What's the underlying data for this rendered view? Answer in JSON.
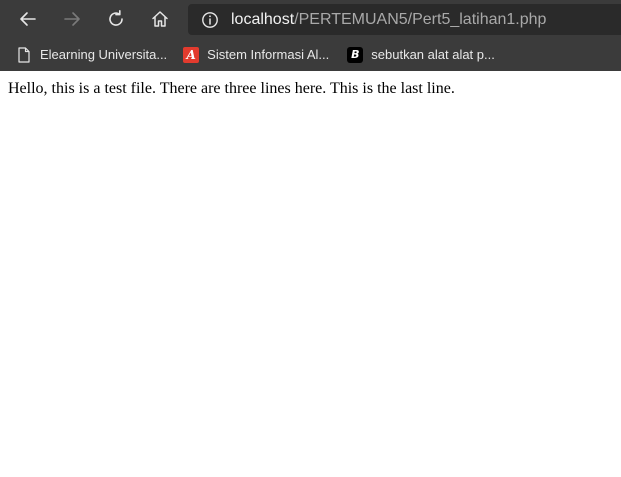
{
  "browser": {
    "address_bar": {
      "url_host": "localhost",
      "url_path": "/PERTEMUAN5/Pert5_latihan1.php"
    },
    "bookmarks": [
      {
        "label": "Elearning Universita...",
        "icon": "page-icon"
      },
      {
        "label": "Sistem Informasi Al...",
        "icon": "red-a-badge-icon"
      },
      {
        "label": "sebutkan alat alat p...",
        "icon": "black-b-badge-icon"
      }
    ],
    "colors": {
      "chrome": "#3b3b3b",
      "address_bar": "#2a2a2a",
      "text_light": "#f2f2f2",
      "text_dim": "#a9a9a9"
    }
  },
  "page": {
    "text": "Hello, this is a test file. There are three lines here. This is the last line."
  }
}
